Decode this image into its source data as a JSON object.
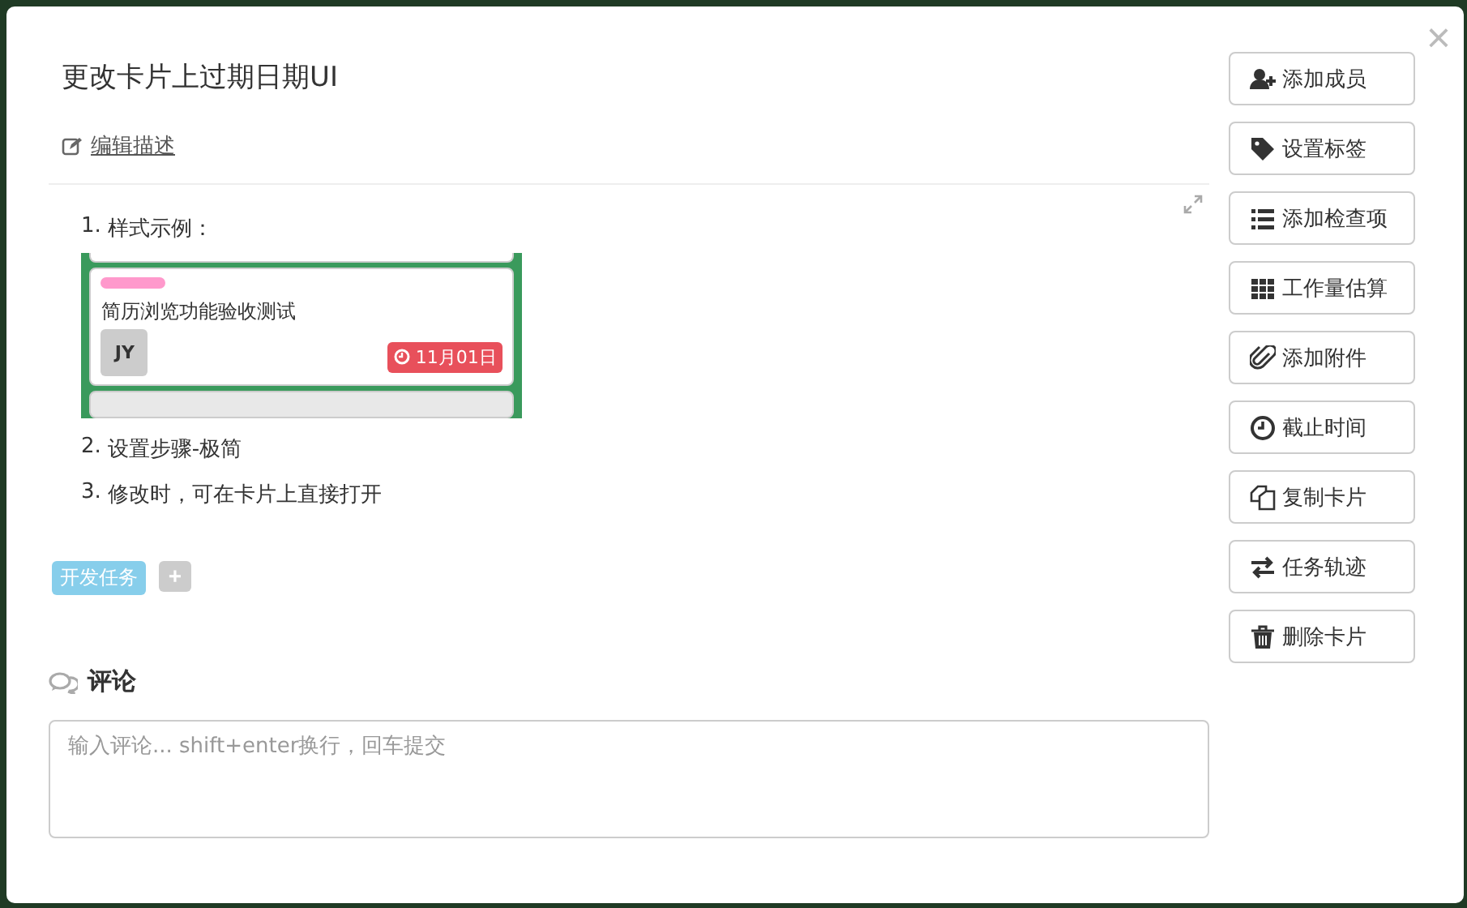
{
  "modal": {
    "title": "更改卡片上过期日期UI",
    "close": "×",
    "edit_link": "编辑描述"
  },
  "description": {
    "items": [
      {
        "number": "1.",
        "text": "样式示例：",
        "example_card": {
          "title": "简历浏览功能验收测试",
          "avatar": "JY",
          "due": "11月01日"
        }
      },
      {
        "number": "2.",
        "text": "设置步骤-极简"
      },
      {
        "number": "3.",
        "text": "修改时，可在卡片上直接打开"
      }
    ]
  },
  "tags": [
    {
      "label": "开发任务",
      "color": "#87ceeb"
    }
  ],
  "add_tag": "+",
  "comments": {
    "heading": "评论",
    "placeholder": "输入评论... shift+enter换行，回车提交"
  },
  "actions": [
    {
      "kind": "member",
      "label": "添加成员"
    },
    {
      "kind": "tag",
      "label": "设置标签"
    },
    {
      "kind": "checklist",
      "label": "添加检查项"
    },
    {
      "kind": "estimate",
      "label": "工作量估算"
    },
    {
      "kind": "attachment",
      "label": "添加附件"
    },
    {
      "kind": "deadline",
      "label": "截止时间"
    },
    {
      "kind": "copy",
      "label": "复制卡片"
    },
    {
      "kind": "track",
      "label": "任务轨迹"
    },
    {
      "kind": "delete",
      "label": "删除卡片"
    }
  ]
}
